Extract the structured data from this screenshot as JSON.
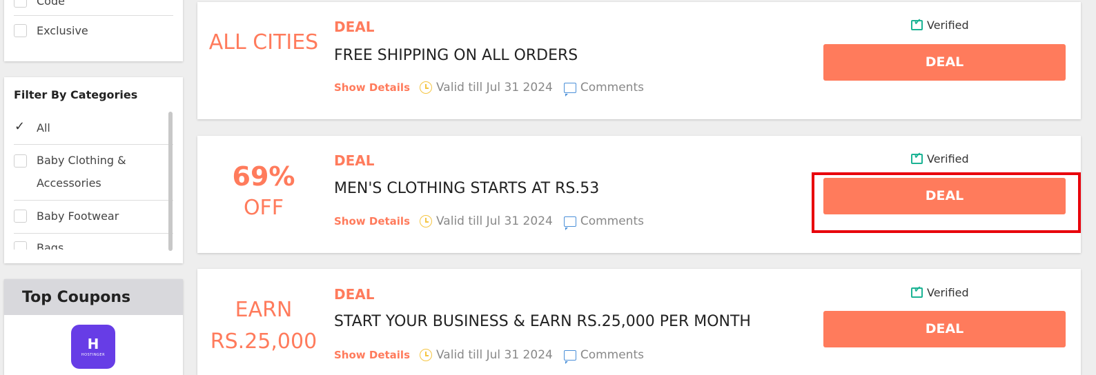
{
  "coupon_type_filter": {
    "items": [
      {
        "label": "Code",
        "checked": false
      },
      {
        "label": "Exclusive",
        "checked": false
      }
    ]
  },
  "category_filter": {
    "title": "Filter By Categories",
    "items": [
      {
        "label": "All",
        "checked": true
      },
      {
        "label": "Baby Clothing & Accessories",
        "checked": false
      },
      {
        "label": "Baby Footwear",
        "checked": false
      },
      {
        "label": "Bags",
        "checked": false
      }
    ]
  },
  "top_coupons": {
    "title": "Top Coupons",
    "logo_text": "HOSTINGER",
    "logo_mark": "H"
  },
  "deals": [
    {
      "badge_line1": "ALL CITIES",
      "badge_line2": "",
      "type": "DEAL",
      "title": "FREE SHIPPING ON ALL ORDERS",
      "show_details": "Show Details",
      "valid": "Valid till Jul 31 2024",
      "comments": "Comments",
      "verified": "Verified",
      "button": "DEAL"
    },
    {
      "badge_line1": "69%",
      "badge_line2": "OFF",
      "type": "DEAL",
      "title": "MEN'S CLOTHING STARTS AT RS.53",
      "show_details": "Show Details",
      "valid": "Valid till Jul 31 2024",
      "comments": "Comments",
      "verified": "Verified",
      "button": "DEAL"
    },
    {
      "badge_line1": "EARN",
      "badge_line2": "RS.25,000",
      "type": "DEAL",
      "title": "START YOUR BUSINESS & EARN RS.25,000 PER MONTH",
      "show_details": "Show Details",
      "valid": "Valid till Jul 31 2024",
      "comments": "Comments",
      "verified": "Verified",
      "button": "DEAL"
    }
  ],
  "colors": {
    "accent": "#ff7b5c",
    "verified": "#1bb394",
    "highlight": "#e8000b",
    "logo_bg": "#673de6"
  },
  "icons": [
    "checkbox-icon",
    "clock-icon",
    "comment-icon",
    "verified-check-icon"
  ]
}
